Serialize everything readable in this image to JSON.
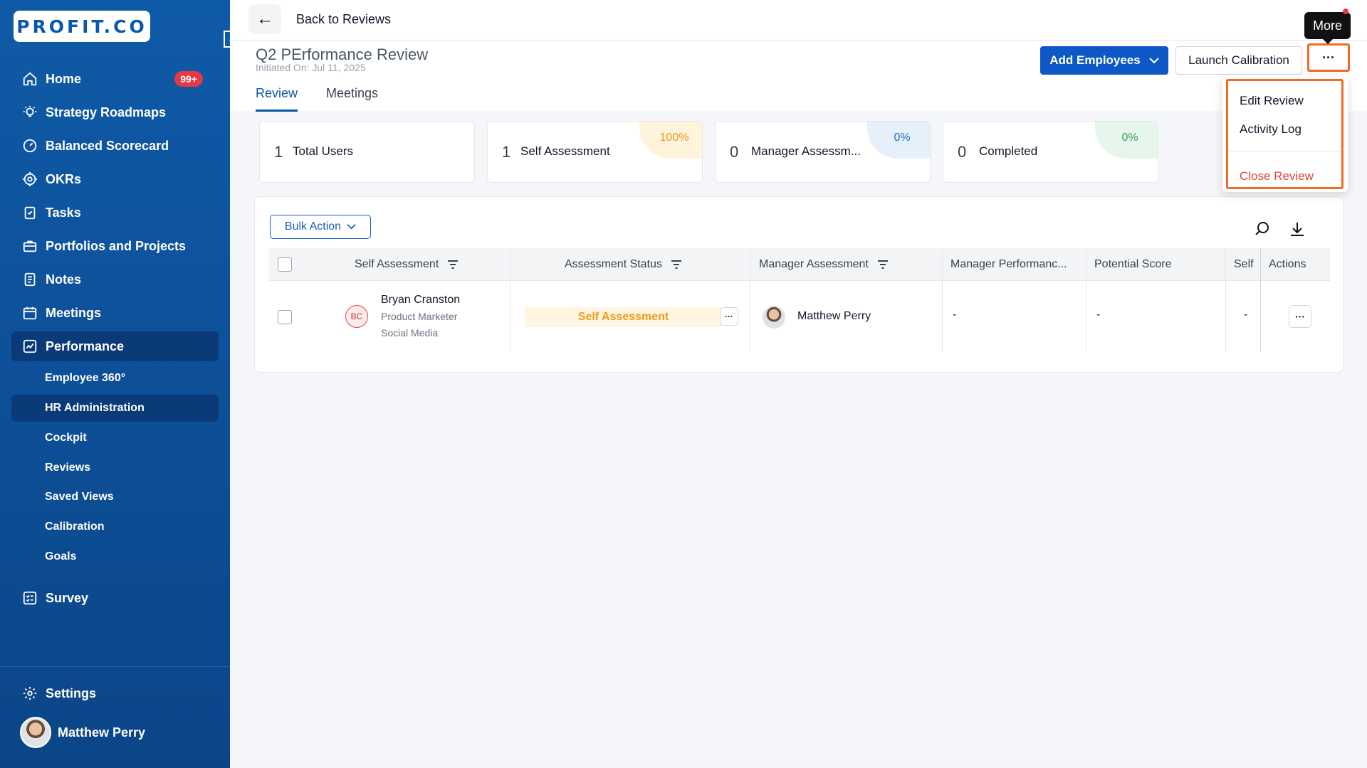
{
  "sidebar": {
    "logo": "PROFIT.CO",
    "items": [
      {
        "label": "Home",
        "badge": "99+"
      },
      {
        "label": "Strategy Roadmaps"
      },
      {
        "label": "Balanced Scorecard"
      },
      {
        "label": "OKRs"
      },
      {
        "label": "Tasks"
      },
      {
        "label": "Portfolios and Projects"
      },
      {
        "label": "Notes"
      },
      {
        "label": "Meetings"
      },
      {
        "label": "Performance"
      }
    ],
    "sub_items": [
      "Employee 360°",
      "HR Administration",
      "Cockpit",
      "Reviews",
      "Saved Views",
      "Calibration",
      "Goals"
    ],
    "survey": "Survey",
    "settings": "Settings",
    "user_name": "Matthew Perry"
  },
  "topbar": {
    "back_label": "Back to Reviews"
  },
  "header": {
    "title": "Q2 PErformance Review",
    "initiated": "Initiated On: Jul 11, 2025",
    "tabs": [
      "Review",
      "Meetings"
    ],
    "add_employees": "Add Employees",
    "launch_calibration": "Launch Calibration",
    "more_tooltip": "More",
    "more_button": "···"
  },
  "more_menu": {
    "edit": "Edit Review",
    "activity": "Activity Log",
    "close": "Close Review"
  },
  "cards": [
    {
      "num": "1",
      "label": "Total Users",
      "pct": ""
    },
    {
      "num": "1",
      "label": "Self Assessment",
      "pct": "100%"
    },
    {
      "num": "0",
      "label": "Manager Assessm...",
      "pct": "0%"
    },
    {
      "num": "0",
      "label": "Completed",
      "pct": "0%"
    }
  ],
  "table": {
    "bulk_action": "Bulk Action",
    "headers": [
      "Self Assessment",
      "Assessment Status",
      "Manager Assessment",
      "Manager Performanc...",
      "Potential Score",
      "Self",
      "Actions"
    ],
    "row": {
      "initials": "BC",
      "name": "Bryan Cranston",
      "role": "Product Marketer",
      "dept": "Social Media",
      "status": "Self Assessment",
      "manager": "Matthew Perry",
      "mgr_perf": "-",
      "potential": "-",
      "self": "-",
      "dots": "···"
    }
  },
  "colors": {
    "brand": "#0d57a8",
    "accent": "#f06a2a",
    "danger": "#e2463a"
  }
}
